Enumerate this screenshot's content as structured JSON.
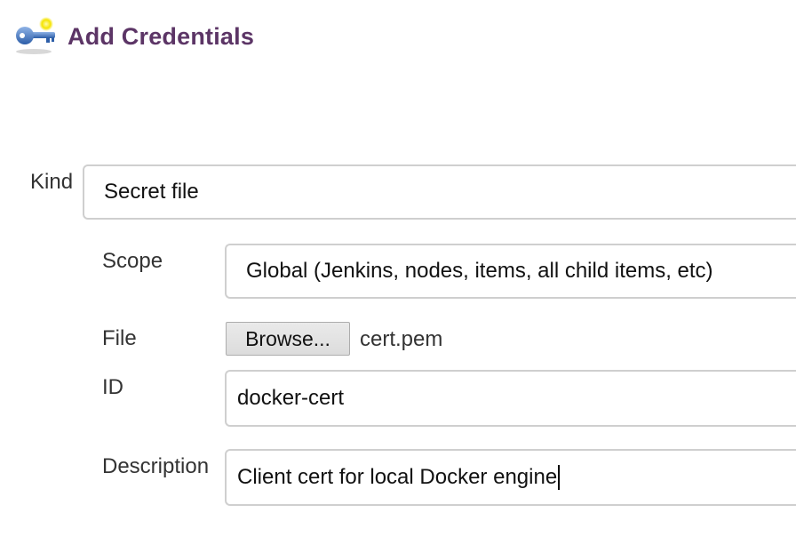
{
  "header": {
    "title": "Add Credentials",
    "icon": "credentials-key-icon"
  },
  "form": {
    "kind": {
      "label": "Kind",
      "value": "Secret file"
    },
    "scope": {
      "label": "Scope",
      "value": "Global (Jenkins, nodes, items, all child items, etc)"
    },
    "file": {
      "label": "File",
      "button_label": "Browse...",
      "filename": "cert.pem"
    },
    "id": {
      "label": "ID",
      "value": "docker-cert"
    },
    "description": {
      "label": "Description",
      "value": "Client cert for local Docker engine"
    }
  },
  "colors": {
    "title": "#5c3566",
    "key_blue": "#3f6fb5",
    "key_glow": "#f5e400"
  }
}
